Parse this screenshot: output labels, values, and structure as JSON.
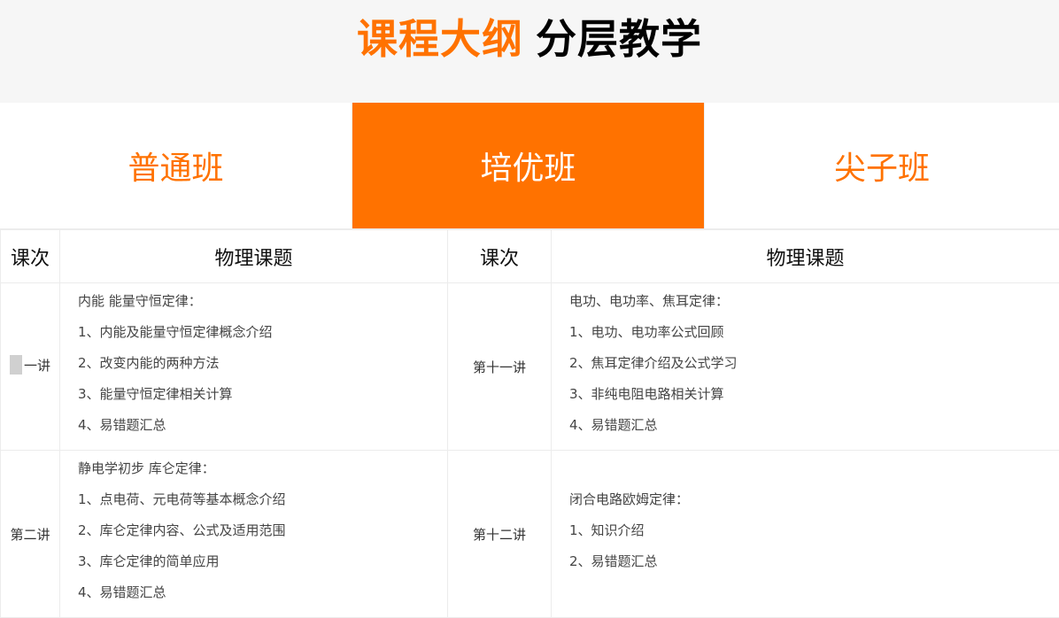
{
  "header": {
    "title_accent": "课程大纲",
    "title_main": "分层教学"
  },
  "tabs": [
    {
      "label": "普通班"
    },
    {
      "label": "培优班"
    },
    {
      "label": "尖子班"
    }
  ],
  "table": {
    "headers": [
      "课次",
      "物理课题",
      "课次",
      "物理课题"
    ],
    "rows": [
      {
        "left": {
          "lesson": "一讲",
          "heading": "内能 能量守恒定律：",
          "items": [
            "1、内能及能量守恒定律概念介绍",
            "2、改变内能的两种方法",
            "3、能量守恒定律相关计算",
            "4、易错题汇总"
          ]
        },
        "right": {
          "lesson": "第十一讲",
          "heading": "电功、电功率、焦耳定律：",
          "items": [
            "1、电功、电功率公式回顾",
            "2、焦耳定律介绍及公式学习",
            "3、非纯电阻电路相关计算",
            "4、易错题汇总"
          ]
        }
      },
      {
        "left": {
          "lesson": "第二讲",
          "heading": "静电学初步 库仑定律：",
          "items": [
            "1、点电荷、元电荷等基本概念介绍",
            "2、库仑定律内容、公式及适用范围",
            "3、库仑定律的简单应用",
            "4、易错题汇总"
          ]
        },
        "right": {
          "lesson": "第十二讲",
          "heading": "闭合电路欧姆定律：",
          "items": [
            "1、知识介绍",
            "2、易错题汇总"
          ]
        }
      }
    ]
  }
}
